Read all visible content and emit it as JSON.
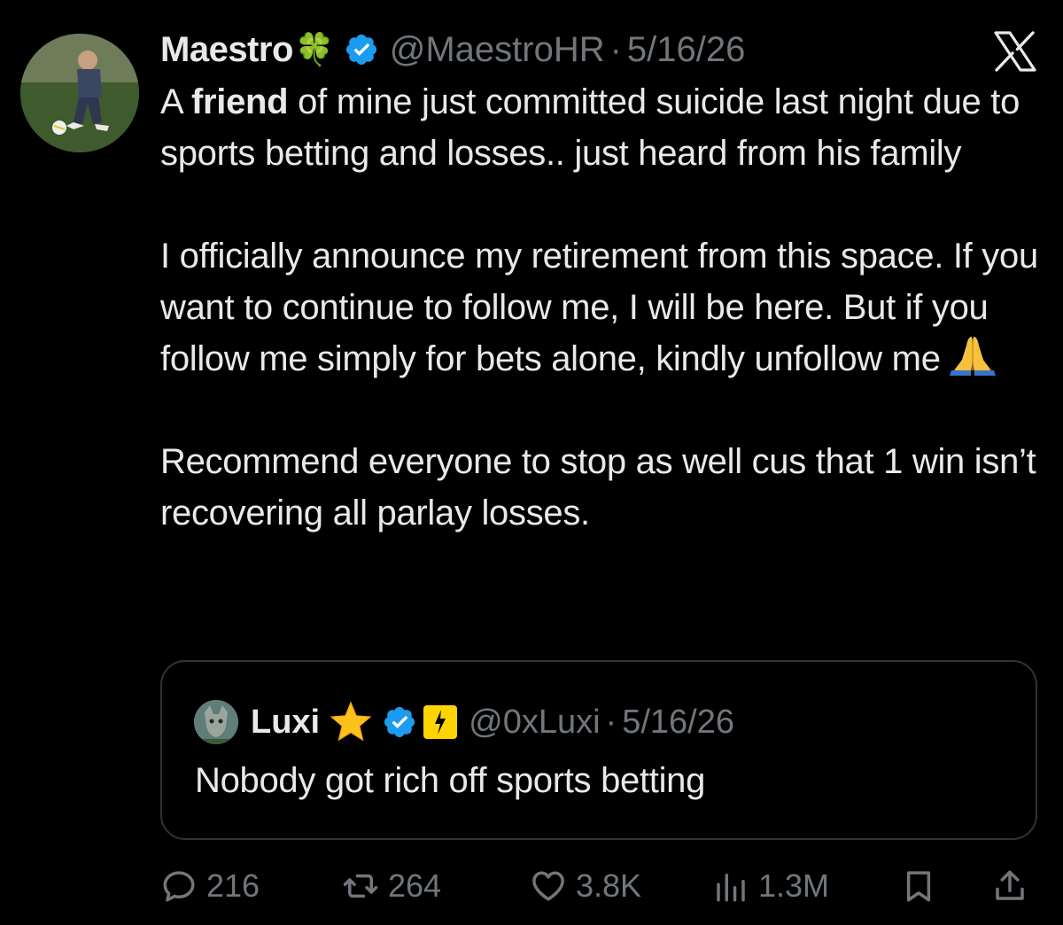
{
  "tweet": {
    "author": {
      "display_name": "Maestro",
      "name_emoji_icon": "four-leaf-clover",
      "handle": "@MaestroHR",
      "separator": "·",
      "date": "5/16/26",
      "verified": true
    },
    "platform_logo": "X",
    "paragraphs": [
      {
        "pre": "A ",
        "bold": "friend",
        "post": " of mine just committed suicide last night due to sports betting and losses..  just heard from his family"
      },
      {
        "text": "I officially announce my retirement from this space. If you want to continue to follow me, I will be here. But if you follow me simply for bets alone, kindly unfollow me",
        "trailing_emoji_icon": "folded-hands"
      },
      {
        "text": "Recommend everyone to stop as well cus that 1 win isn’t recovering all parlay losses."
      }
    ],
    "quoted": {
      "display_name": "Luxi",
      "name_emoji_icon": "star",
      "verified": true,
      "badge_icon": "yellow-org-badge",
      "handle": "@0xLuxi",
      "separator": "·",
      "date": "5/16/26",
      "text": "Nobody got rich off sports betting"
    },
    "metrics": {
      "replies": "216",
      "reposts": "264",
      "likes": "3.8K",
      "views": "1.3M"
    }
  },
  "colors": {
    "background": "#000000",
    "text_primary": "#e7e9ea",
    "text_secondary": "#71767b",
    "verified_blue": "#1d9bf0",
    "card_border": "#2f3336"
  }
}
